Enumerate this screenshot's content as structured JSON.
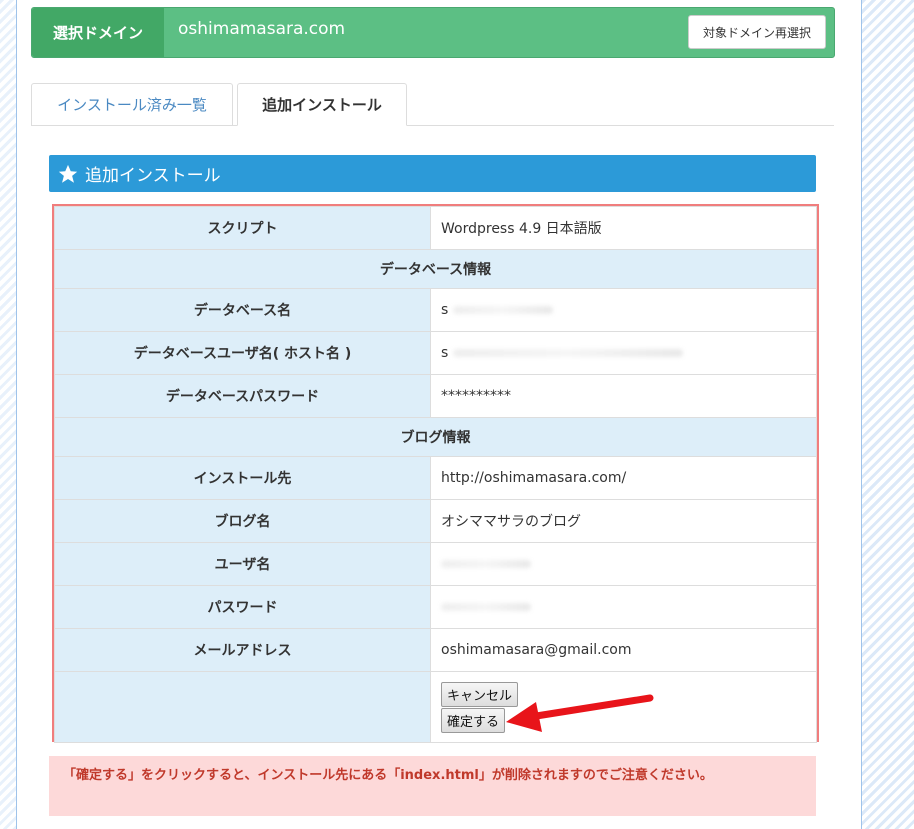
{
  "domain_bar": {
    "label": "選択ドメイン",
    "domain": "oshimamasara.com",
    "reselect_button": "対象ドメイン再選択"
  },
  "tabs": [
    {
      "label": "インストール済み一覧",
      "active": false
    },
    {
      "label": "追加インストール",
      "active": true
    }
  ],
  "section": {
    "title": "追加インストール",
    "icon": "star-icon"
  },
  "form": {
    "script_label": "スクリプト",
    "script_value": "Wordpress 4.9 日本語版",
    "db_group": "データベース情報",
    "db_name_label": "データベース名",
    "db_name_value": "s",
    "db_user_label": "データベースユーザ名( ホスト名 )",
    "db_user_value": "s",
    "db_password_label": "データベースパスワード",
    "db_password_value": "**********",
    "blog_group": "ブログ情報",
    "install_to_label": "インストール先",
    "install_to_value": "http://oshimamasara.com/",
    "blog_name_label": "ブログ名",
    "blog_name_value": "オシママサラのブログ",
    "user_label": "ユーザ名",
    "password_label": "パスワード",
    "email_label": "メールアドレス",
    "email_value": "oshimamasara@gmail.com",
    "cancel_button": "キャンセル",
    "confirm_button": "確定する"
  },
  "warning": "「確定する」をクリックすると、インストール先にある「index.html」が削除されますのでご注意ください。",
  "colors": {
    "domain_bar": "#5cbf84",
    "section_header": "#2c9ad8",
    "table_border": "#f07d7d",
    "warning_bg": "#fdd9d9",
    "warning_text": "#c0392b",
    "arrow": "#e8141a"
  }
}
